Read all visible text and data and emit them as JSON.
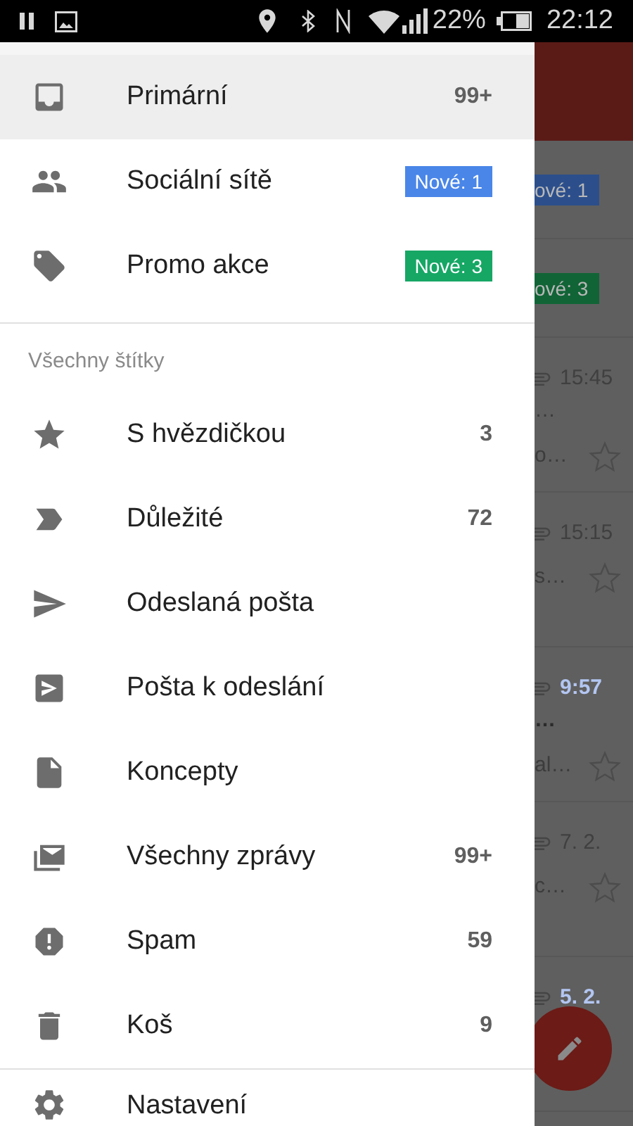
{
  "status_bar": {
    "battery": "22%",
    "time": "22:12"
  },
  "drawer": {
    "inboxes": [
      {
        "label": "Primární",
        "count": "99+",
        "selected": true
      },
      {
        "label": "Sociální sítě",
        "badge": {
          "text": "Nové: 1",
          "color": "#4a86e8"
        },
        "selected": false
      },
      {
        "label": "Promo akce",
        "badge": {
          "text": "Nové: 3",
          "color": "#16a765"
        },
        "selected": false
      }
    ],
    "labels_header": "Všechny štítky",
    "labels": [
      {
        "label": "S hvězdičkou",
        "count": "3",
        "selected": false
      },
      {
        "label": "Důležité",
        "count": "72",
        "selected": false
      },
      {
        "label": "Odeslaná pošta",
        "selected": false
      },
      {
        "label": "Pošta k odeslání",
        "selected": false
      },
      {
        "label": "Koncepty",
        "selected": false
      },
      {
        "label": "Všechny zprávy",
        "count": "99+",
        "selected": false
      },
      {
        "label": "Spam",
        "count": "59",
        "selected": false
      },
      {
        "label": "Koš",
        "count": "9",
        "selected": false
      }
    ],
    "settings": {
      "label": "Nastavení"
    }
  },
  "background": {
    "badges": [
      {
        "text": "ové: 1",
        "color": "#2c4f8c"
      },
      {
        "text": "ové: 3",
        "color": "#116436"
      }
    ],
    "messages": [
      {
        "time": "15:45",
        "unread": false,
        "lines": [
          "…",
          "o…"
        ],
        "starred": false
      },
      {
        "time": "15:15",
        "unread": false,
        "lines": [
          "s…"
        ],
        "starred": false
      },
      {
        "time": "9:57",
        "unread": true,
        "lines": [
          "…",
          "al…"
        ],
        "starred": false
      },
      {
        "time": "7. 2.",
        "unread": false,
        "lines": [
          "c…"
        ],
        "starred": false
      },
      {
        "time": "5. 2.",
        "unread": true
      }
    ]
  }
}
